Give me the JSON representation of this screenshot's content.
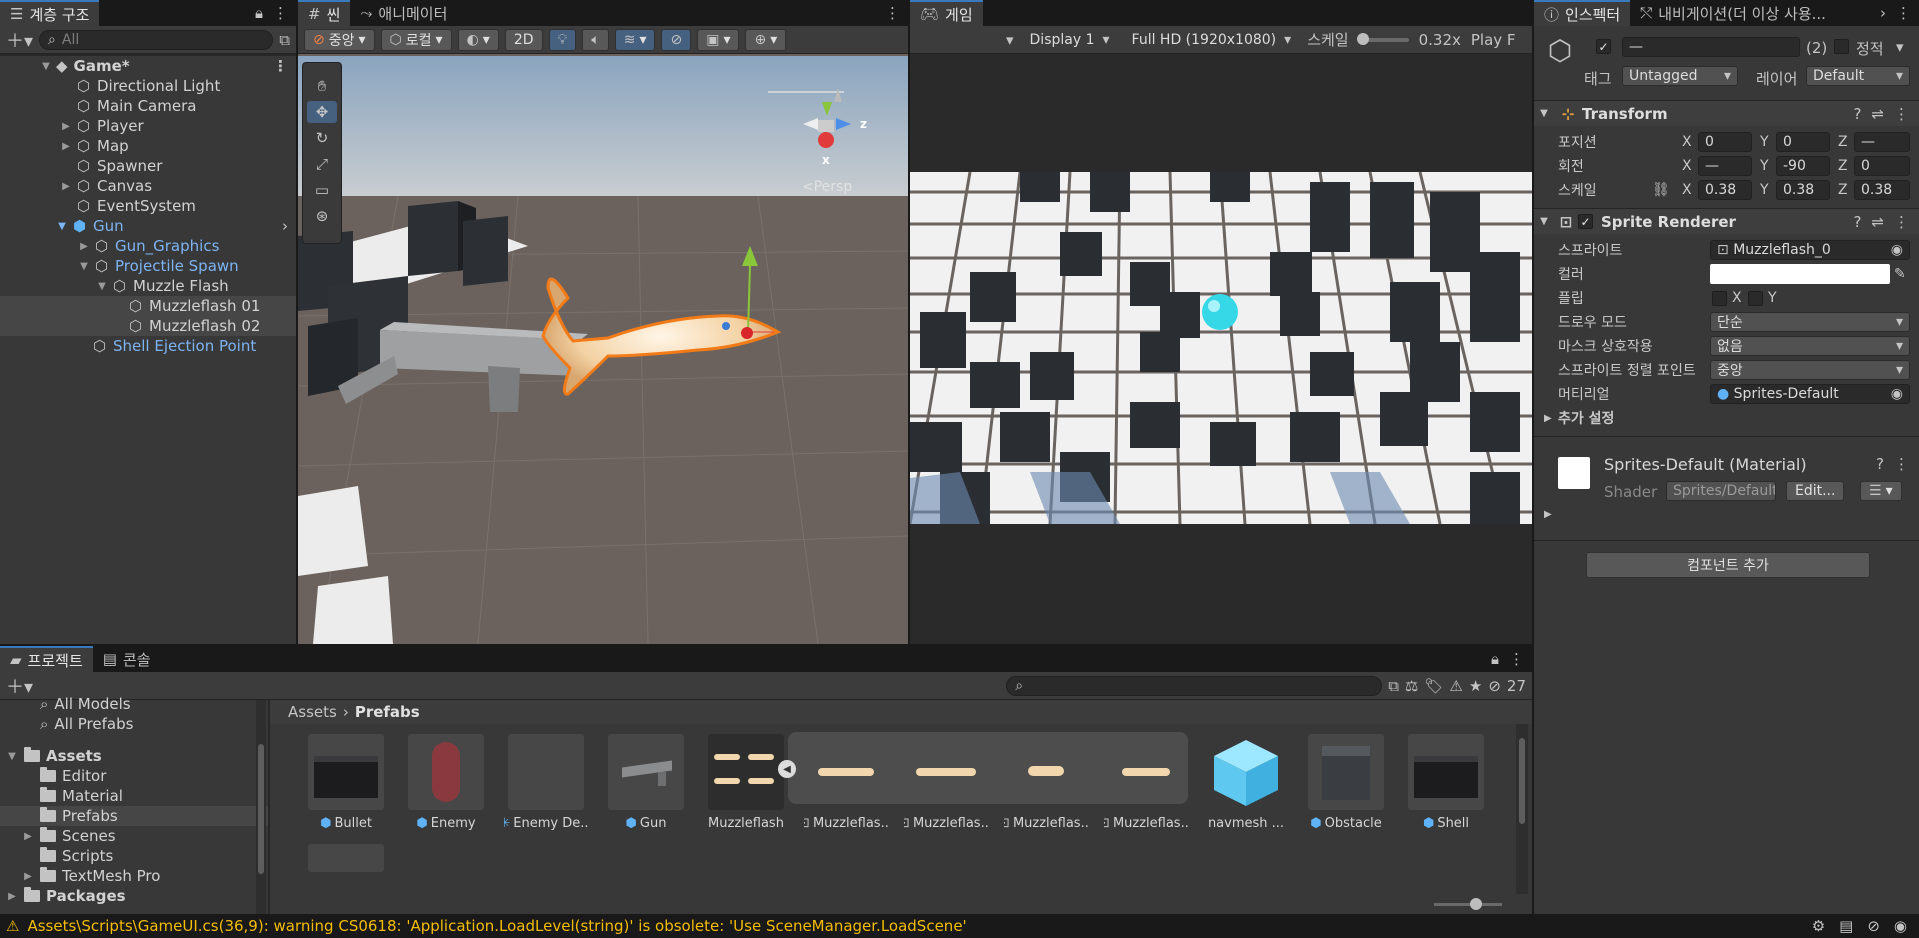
{
  "hierarchy": {
    "tab_label": "계층 구조",
    "search_placeholder": "All",
    "scene_name": "Game*",
    "items": [
      {
        "label": "Directional Light"
      },
      {
        "label": "Main Camera"
      },
      {
        "label": "Player"
      },
      {
        "label": "Map"
      },
      {
        "label": "Spawner"
      },
      {
        "label": "Canvas"
      },
      {
        "label": "EventSystem"
      },
      {
        "label": "Gun"
      },
      {
        "label": "Gun_Graphics"
      },
      {
        "label": "Projectile Spawn"
      },
      {
        "label": "Muzzle Flash"
      },
      {
        "label": "Muzzleflash 01"
      },
      {
        "label": "Muzzleflash 02"
      },
      {
        "label": "Shell Ejection Point"
      }
    ]
  },
  "scene": {
    "tab_label": "씬",
    "animator_tab": "애니메이터",
    "pivot_label": "중앙",
    "space_label": "로컬",
    "mode_2d": "2D",
    "persp_label": "Persp",
    "gizmo_x": "x",
    "gizmo_z": "z"
  },
  "game": {
    "tab_label": "게임",
    "display": "Display 1",
    "resolution": "Full HD (1920x1080)",
    "scale_label": "스케일",
    "scale_value": "0.32x",
    "play_label": "Play F"
  },
  "inspector": {
    "tab_label": "인스펙터",
    "nav_tab_label": "내비게이션(더 이상 사용...",
    "name_value": "—",
    "count": "(2)",
    "static_label": "정적",
    "tag_label": "태그",
    "tag_value": "Untagged",
    "layer_label": "레이어",
    "layer_value": "Default",
    "transform": {
      "title": "Transform",
      "position_label": "포지션",
      "rotation_label": "회전",
      "scale_label": "스케일",
      "pos": {
        "x": "0",
        "y": "0",
        "z": "—"
      },
      "rot": {
        "x": "—",
        "y": "-90",
        "z": "0"
      },
      "scl": {
        "x": "0.38",
        "y": "0.38",
        "z": "0.38"
      },
      "axis_x": "X",
      "axis_y": "Y",
      "axis_z": "Z"
    },
    "sprite_renderer": {
      "title": "Sprite Renderer",
      "sprite_label": "스프라이트",
      "sprite_value": "Muzzleflash_0",
      "color_label": "컬러",
      "flip_label": "플립",
      "flip_x": "X",
      "flip_y": "Y",
      "draw_mode_label": "드로우 모드",
      "draw_mode_value": "단순",
      "mask_label": "마스크 상호작용",
      "mask_value": "없음",
      "sort_label": "스프라이트 정렬 포인트",
      "sort_value": "중앙",
      "material_label": "머티리얼",
      "material_value": "Sprites-Default",
      "additional_label": "추가 설정"
    },
    "material": {
      "title": "Sprites-Default (Material)",
      "shader_label": "Shader",
      "shader_value": "Sprites/Default",
      "edit_button": "Edit..."
    },
    "add_component": "컴포넌트 추가"
  },
  "project": {
    "tab_label": "프로젝트",
    "console_tab": "콘솔",
    "hidden_count": "27",
    "tree": [
      {
        "label": "All Models"
      },
      {
        "label": "All Prefabs"
      },
      {
        "label": "Assets"
      },
      {
        "label": "Editor"
      },
      {
        "label": "Material"
      },
      {
        "label": "Prefabs"
      },
      {
        "label": "Scenes"
      },
      {
        "label": "Scripts"
      },
      {
        "label": "TextMesh Pro"
      },
      {
        "label": "Packages"
      }
    ],
    "breadcrumb_root": "Assets",
    "breadcrumb_current": "Prefabs",
    "assets": [
      {
        "label": "Bullet"
      },
      {
        "label": "Enemy"
      },
      {
        "label": "Enemy De..."
      },
      {
        "label": "Gun"
      },
      {
        "label": "Muzzleflash"
      },
      {
        "label": "Muzzleflas..."
      },
      {
        "label": "Muzzleflas..."
      },
      {
        "label": "Muzzleflas..."
      },
      {
        "label": "Muzzleflas..."
      },
      {
        "label": "navmesh ..."
      },
      {
        "label": "Obstacle"
      },
      {
        "label": "Shell"
      }
    ]
  },
  "status": {
    "message": "Assets\\Scripts\\GameUI.cs(36,9): warning CS0618: 'Application.LoadLevel(string)' is obsolete: 'Use SceneManager.LoadScene'"
  },
  "colors": {
    "selection_blue": "#3a79bb",
    "prefab_blue": "#7cb4f4",
    "warning_yellow": "#f4bc02",
    "orange_outline": "#f37b17"
  }
}
